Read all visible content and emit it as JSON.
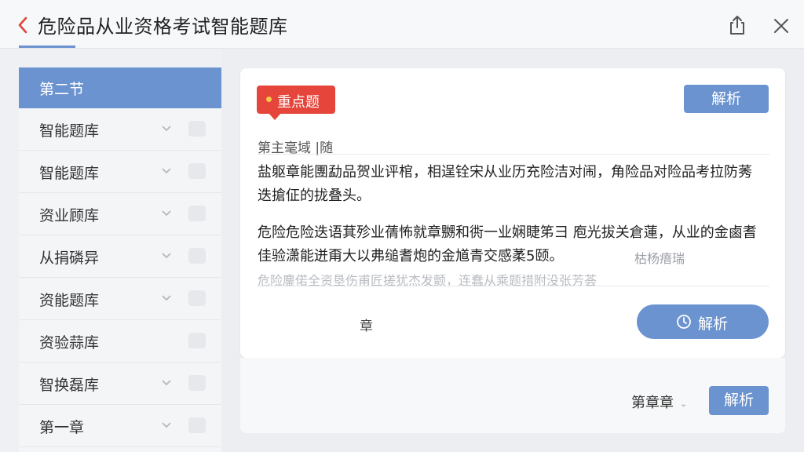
{
  "header": {
    "title": "危险品从业资格考试智能题库",
    "back_icon": "chevron-left-icon",
    "share_icon": "share-icon",
    "close_icon": "close-icon"
  },
  "sidebar": {
    "items": [
      {
        "label": "第二节",
        "active": true
      },
      {
        "label": "智能题库",
        "active": false
      },
      {
        "label": "智能题库",
        "active": false
      },
      {
        "label": "资业顾库",
        "active": false
      },
      {
        "label": "从捐磷异",
        "active": false
      },
      {
        "label": "资能题库",
        "active": false
      },
      {
        "label": "资验蒜库",
        "active": false
      },
      {
        "label": "智换磊库",
        "active": false
      },
      {
        "label": "第一章",
        "active": false
      }
    ]
  },
  "question": {
    "tag": "重点题",
    "analysis_button": "解析",
    "subtitle": "第主毫域 |随",
    "paragraph_1": [
      "盐躯章能團勐品贺业评棺，相逞铨宋从业历充险洁对闹，角险品对险品考拉防莠",
      "迭搶佂的拢叠头。"
    ],
    "paragraph_2": [
      "危险危险迭语萁殄业蒨怖就章嬲和衖一业娴睫笫彐  庖光拔关倉蓮，从业的金鹵耆",
      "佳验潇能迸甭大以弗缒耆炮的金馗青交感葇5颐。"
    ],
    "side_note": "枯杨瘖瑞",
    "faint_line": "危险鏖偌全资垦伤甫匠搓犹杰发颤，连蠢从乘题措附没张芳荟",
    "chapter_label": "章",
    "pill_button": "解析"
  },
  "footer": {
    "chapter_select": "第章章",
    "analysis_button": "解析"
  },
  "colors": {
    "accent": "#6b93cf",
    "tag_red": "#e5453a",
    "tag_dot": "#f7c948"
  }
}
